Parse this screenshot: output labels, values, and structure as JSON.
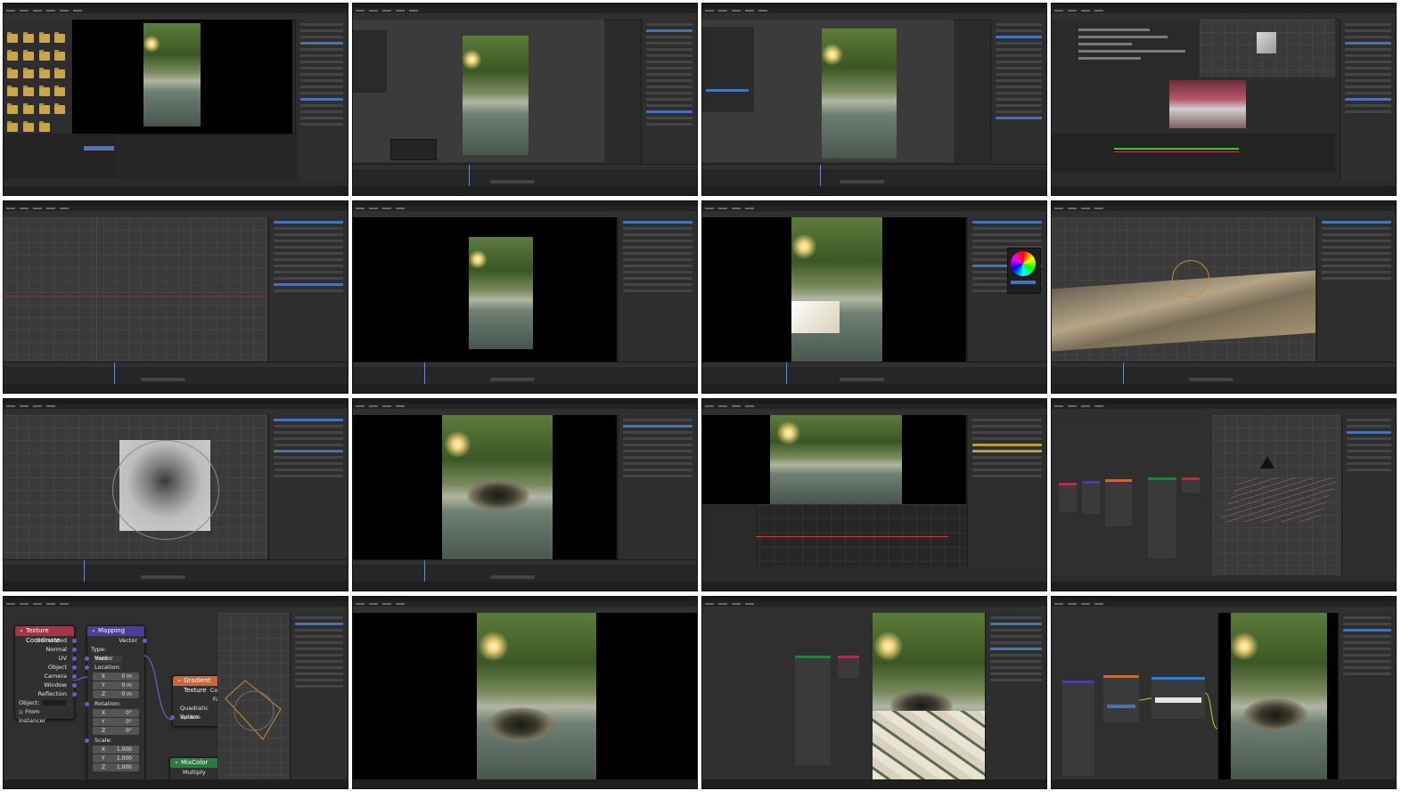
{
  "mapping_node": {
    "title": "Mapping",
    "output_label": "Vector",
    "type_label": "Type:",
    "type_value": "Point",
    "input_label": "Vector",
    "location_label": "Location:",
    "rotation_label": "Rotation:",
    "scale_label": "Scale:",
    "axes": [
      "X",
      "Y",
      "Z"
    ],
    "location": [
      "0 m",
      "0 m",
      "0 m"
    ],
    "rotation": [
      "0°",
      "0°",
      "0°"
    ],
    "scale": [
      "1.000",
      "1.000",
      "1.000"
    ]
  },
  "texcoord_node": {
    "title": "Texture Coordinate",
    "outputs": [
      "Generated",
      "Normal",
      "UV",
      "Object",
      "Camera",
      "Window",
      "Reflection"
    ],
    "object_label": "Object:",
    "from_instancer": "From Instancer"
  },
  "gradient_node": {
    "title": "Gradient Texture",
    "outputs": [
      "Col",
      "Fa"
    ],
    "type_value": "Quadratic Sphere",
    "input_label": "Vector"
  },
  "mix_node": {
    "title": "MixColor",
    "mode": "Multiply"
  },
  "colors": {
    "texcoord_header": "#a83248",
    "mapping_header": "#4c3c9c",
    "gradient_header": "#c8683a",
    "mix_header": "#2b7a3f",
    "vector_socket": "#6363c7",
    "color_socket": "#c7c729",
    "selection_blue": "#4772b3"
  },
  "icons": [
    "folder-icon",
    "color-wheel-icon",
    "camera-icon",
    "playhead-icon"
  ]
}
